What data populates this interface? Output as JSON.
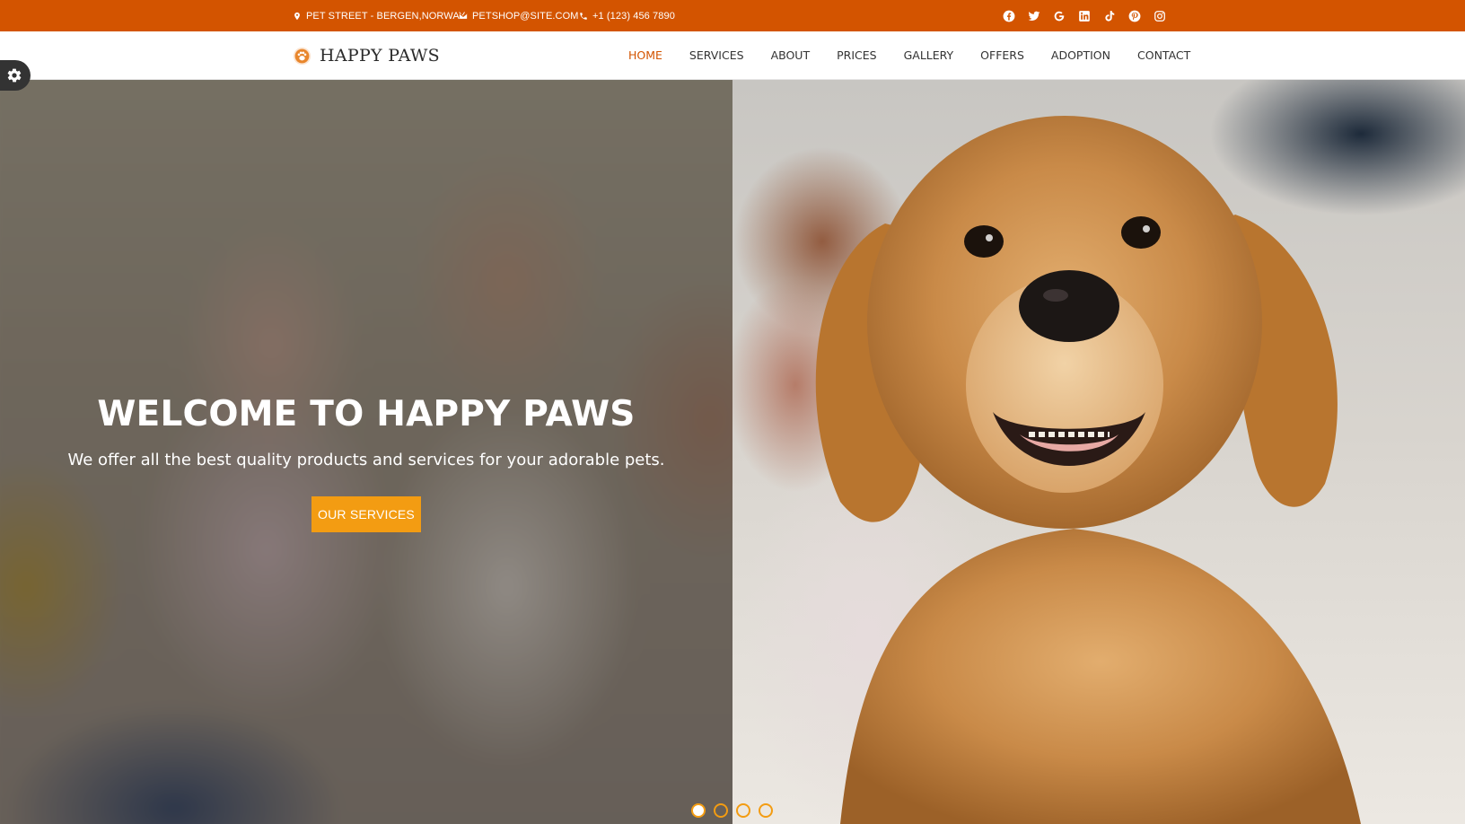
{
  "topbar": {
    "address": "PET STREET - BERGEN,NORWAY",
    "email": "PETSHOP@SITE.COM",
    "phone": "+1 (123) 456 7890",
    "social_icons": [
      "facebook-icon",
      "twitter-icon",
      "google-icon",
      "linkedin-icon",
      "tiktok-icon",
      "pinterest-icon",
      "instagram-icon"
    ]
  },
  "brand": {
    "name": "HAPPY PAWS",
    "logo_icon": "paw-icon"
  },
  "nav": {
    "items": [
      {
        "label": "HOME",
        "active": true
      },
      {
        "label": "SERVICES",
        "active": false
      },
      {
        "label": "ABOUT",
        "active": false
      },
      {
        "label": "PRICES",
        "active": false
      },
      {
        "label": "GALLERY",
        "active": false
      },
      {
        "label": "OFFERS",
        "active": false
      },
      {
        "label": "ADOPTION",
        "active": false
      },
      {
        "label": "CONTACT",
        "active": false
      }
    ]
  },
  "settings": {
    "icon": "gear-icon"
  },
  "hero": {
    "title": "WELCOME TO HAPPY PAWS",
    "subtitle": "We offer all the best quality products and services for your adorable pets.",
    "button_label": "OUR SERVICES",
    "slides": 4,
    "active_slide": 1
  },
  "colors": {
    "topbar_bg": "#d35400",
    "accent": "#d35400",
    "button": "#f39c12",
    "nav_text": "#333333",
    "settings_bg": "#333333"
  }
}
